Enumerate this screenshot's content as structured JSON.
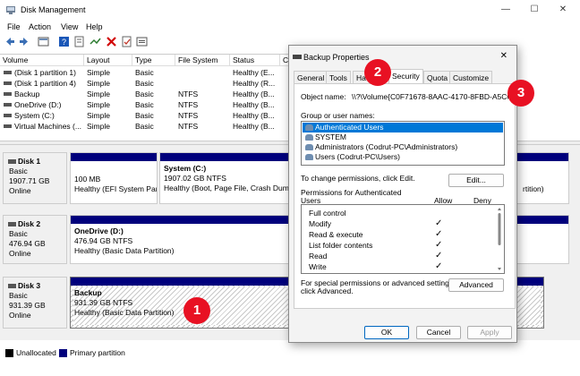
{
  "app": {
    "title": "Disk Management",
    "window_controls": {
      "minimize": "—",
      "maximize": "☐",
      "close": "✕"
    }
  },
  "menu": [
    "File",
    "Action",
    "View",
    "Help"
  ],
  "toolbar": {
    "icons": [
      "back-arrow-icon",
      "forward-arrow-icon",
      "list-view-icon",
      "help-icon",
      "properties-icon",
      "connect-icon",
      "delete-icon",
      "check-icon",
      "refresh-icon"
    ],
    "colors": {
      "delete": "#d10000",
      "help": "#1a57b8"
    }
  },
  "volume_list": {
    "headers": [
      "Volume",
      "Layout",
      "Type",
      "File System",
      "Status",
      "C"
    ],
    "rows": [
      {
        "volume": "(Disk 1 partition 1)",
        "layout": "Simple",
        "type": "Basic",
        "fs": "",
        "status": "Healthy (E..."
      },
      {
        "volume": "(Disk 1 partition 4)",
        "layout": "Simple",
        "type": "Basic",
        "fs": "",
        "status": "Healthy (R..."
      },
      {
        "volume": "Backup",
        "layout": "Simple",
        "type": "Basic",
        "fs": "NTFS",
        "status": "Healthy (B..."
      },
      {
        "volume": "OneDrive (D:)",
        "layout": "Simple",
        "type": "Basic",
        "fs": "NTFS",
        "status": "Healthy (B..."
      },
      {
        "volume": "System (C:)",
        "layout": "Simple",
        "type": "Basic",
        "fs": "NTFS",
        "status": "Healthy (B..."
      },
      {
        "volume": "Virtual Machines (...",
        "layout": "Simple",
        "type": "Basic",
        "fs": "NTFS",
        "status": "Healthy (B..."
      }
    ]
  },
  "disks": [
    {
      "name": "Disk 1",
      "type": "Basic",
      "size": "1907.71 GB",
      "state": "Online",
      "partitions": [
        {
          "name": "",
          "size": "100 MB",
          "status": "Healthy (EFI System Par"
        },
        {
          "name": "System  (C:)",
          "size": "1907.02 GB NTFS",
          "status": "Healthy (Boot, Page File, Crash Dump"
        },
        {
          "name": "",
          "size": "",
          "status": "rtition)"
        }
      ]
    },
    {
      "name": "Disk 2",
      "type": "Basic",
      "size": "476.94 GB",
      "state": "Online",
      "partitions": [
        {
          "name": "OneDrive  (D:)",
          "size": "476.94 GB NTFS",
          "status": "Healthy (Basic Data Partition)"
        }
      ]
    },
    {
      "name": "Disk 3",
      "type": "Basic",
      "size": "931.39 GB",
      "state": "Online",
      "partitions": [
        {
          "name": "Backup",
          "size": "931.39 GB NTFS",
          "status": "Healthy (Basic Data Partition)"
        }
      ]
    }
  ],
  "legend": {
    "unallocated": "Unallocated",
    "primary": "Primary partition",
    "unallocated_color": "#000000",
    "primary_color": "#00007c"
  },
  "dialog": {
    "title": "Backup Properties",
    "close": "✕",
    "tabs": [
      "General",
      "Tools",
      "Ha",
      "Security",
      "Quota",
      "Customize"
    ],
    "active_tab": "Security",
    "object_name_label": "Object name:",
    "object_name_value": "\\\\?\\Volume{C0F71678-8AAC-4170-8FBD-A5C632",
    "group_label": "Group or user names:",
    "groups": [
      "Authenticated Users",
      "SYSTEM",
      "Administrators (Codrut-PC\\Administrators)",
      "Users (Codrut-PC\\Users)"
    ],
    "change_text": "To change permissions, click Edit.",
    "edit_button": "Edit...",
    "perm_label_1": "Permissions for Authenticated",
    "perm_label_2": "Users",
    "allow_header": "Allow",
    "deny_header": "Deny",
    "permissions": [
      {
        "name": "Full control",
        "allow": ""
      },
      {
        "name": "Modify",
        "allow": "✓"
      },
      {
        "name": "Read & execute",
        "allow": "✓"
      },
      {
        "name": "List folder contents",
        "allow": "✓"
      },
      {
        "name": "Read",
        "allow": "✓"
      },
      {
        "name": "Write",
        "allow": "✓"
      }
    ],
    "special_text_1": "For special permissions or advanced settings,",
    "special_text_2": "click Advanced.",
    "advanced_button": "Advanced",
    "ok_button": "OK",
    "cancel_button": "Cancel",
    "apply_button": "Apply"
  },
  "badges": [
    "1",
    "2",
    "3"
  ],
  "badge_color": "#e81123"
}
